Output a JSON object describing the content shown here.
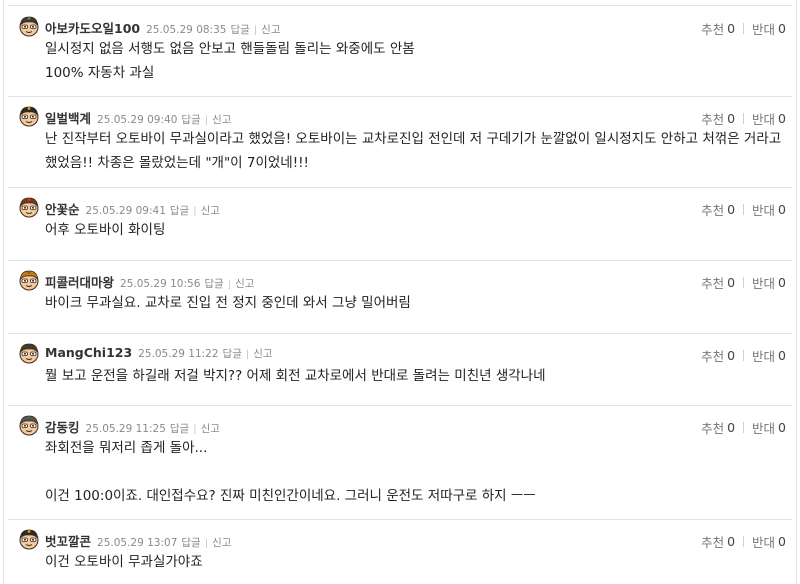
{
  "labels": {
    "reply": "답글",
    "report": "신고",
    "like": "추천",
    "dislike": "반대"
  },
  "colors": {
    "face": "#f5c9a0",
    "outline": "#3b2a1a"
  },
  "comments": [
    {
      "nick": "아보카도오일100",
      "date": "25.05.29 08:35",
      "likes": "0",
      "dislikes": "0",
      "hair": "#3a3a3a",
      "accent": "#5a8a3a",
      "lines": [
        "일시정지 없음 서행도 없음 안보고 핸들돌림 돌리는 와중에도 안봄",
        "100% 자동차 과실"
      ]
    },
    {
      "nick": "일벌백계",
      "date": "25.05.29 09:40",
      "likes": "0",
      "dislikes": "0",
      "hair": "#2a2a2a",
      "accent": "#e0a800",
      "lines": [
        "난 진작부터 오토바이 무과실이라고 했었음! 오토바이는 교차로진입 전인데 저 구데기가 눈깔없이 일시정지도 안하고 처꺾은 거라고",
        "했었음!! 차종은 몰랐었는데 \"개\"이 7이었네!!!"
      ]
    },
    {
      "nick": "안꽃순",
      "date": "25.05.29 09:41",
      "likes": "0",
      "dislikes": "0",
      "hair": "#7a3b12",
      "accent": "#c0392b",
      "lines": [
        "어후 오토바이 화이팅"
      ]
    },
    {
      "nick": "피콜러대마왕",
      "date": "25.05.29 10:56",
      "likes": "0",
      "dislikes": "0",
      "hair": "#c47a1c",
      "accent": "#8a5a2a",
      "lines": [
        "바이크 무과실요. 교차로 진입 전 정지 중인데 와서 그냥 밀어버림"
      ]
    },
    {
      "nick": "MangChi123",
      "date": "25.05.29 11:22",
      "likes": "0",
      "dislikes": "0",
      "hair": "#4a3a2a",
      "accent": "#2c3e50",
      "lines": [
        "뭘 보고 운전을 하길래 저걸 박지?? 어제 회전 교차로에서 반대로 돌려는 미친년 생각나네"
      ]
    },
    {
      "nick": "감동킹",
      "date": "25.05.29 11:25",
      "likes": "0",
      "dislikes": "0",
      "hair": "#555555",
      "accent": "#3f6f3f",
      "lines": [
        "좌회전을 뭐저리 좁게 돌아...",
        "",
        "이건 100:0이죠. 대인접수요? 진짜 미친인간이네요. 그러니 운전도 저따구로 하지 ㅡㅡ"
      ]
    },
    {
      "nick": "벗꼬깔콘",
      "date": "25.05.29 13:07",
      "likes": "0",
      "dislikes": "0",
      "hair": "#2a2a2a",
      "accent": "#d4a017",
      "lines": [
        "이건 오토바이 무과실가야죠"
      ]
    }
  ]
}
